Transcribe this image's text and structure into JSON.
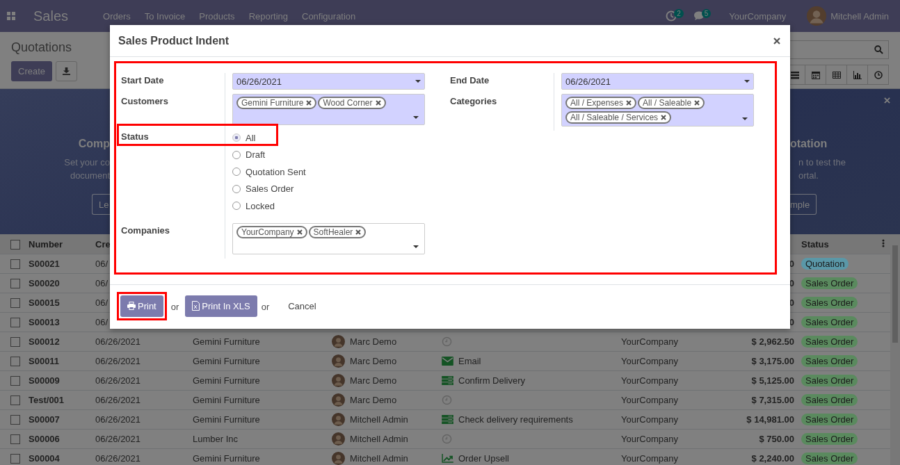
{
  "navbar": {
    "app_name": "Sales",
    "menu": [
      "Orders",
      "To Invoice",
      "Products",
      "Reporting",
      "Configuration"
    ],
    "activity_count": "2",
    "message_count": "5",
    "company": "YourCompany",
    "user": "Mitchell Admin"
  },
  "control_panel": {
    "title": "Quotations",
    "create_button": "Create"
  },
  "banner": {
    "left": {
      "title": "Comp",
      "lines": [
        "Set your co",
        "document"
      ],
      "button": "Le"
    },
    "right": {
      "title": "otation",
      "lines": [
        "n to test the",
        "ortal."
      ],
      "button": "mple"
    }
  },
  "table": {
    "columns": {
      "number": "Number",
      "column_3": "Cre",
      "status": "Status"
    },
    "select_all_checked": false,
    "rows": [
      {
        "checked": false,
        "number": "S00021",
        "date": "06/",
        "total": "0",
        "status": "Quotation",
        "color": "#5a98a8"
      },
      {
        "checked": false,
        "number": "S00020",
        "date": "06/",
        "total": "0",
        "status": "Sales Order",
        "color": "#5a8a5e"
      },
      {
        "checked": false,
        "number": "S00015",
        "date": "06/",
        "total": "0",
        "status": "Sales Order",
        "color": "#5a8a5e"
      },
      {
        "checked": false,
        "number": "S00013",
        "date": "06/",
        "total": "0",
        "status": "Sales Order",
        "color": "#5a8a5e"
      },
      {
        "checked": false,
        "number": "S00012",
        "date": "06/26/2021",
        "customer": "Gemini Furniture",
        "salesperson": "Marc Demo",
        "activity": {
          "kind": "none"
        },
        "company": "YourCompany",
        "total": "$ 2,962.50",
        "status": "Sales Order",
        "color": "#5a8a5e"
      },
      {
        "checked": false,
        "number": "S00011",
        "date": "06/26/2021",
        "customer": "Gemini Furniture",
        "salesperson": "Marc Demo",
        "activity": {
          "kind": "email",
          "text": "Email"
        },
        "company": "YourCompany",
        "total": "$ 3,175.00",
        "status": "Sales Order",
        "color": "#5a8a5e"
      },
      {
        "checked": false,
        "number": "S00009",
        "date": "06/26/2021",
        "customer": "Gemini Furniture",
        "salesperson": "Marc Demo",
        "activity": {
          "kind": "todo",
          "text": "Confirm Delivery"
        },
        "company": "YourCompany",
        "total": "$ 5,125.00",
        "status": "Sales Order",
        "color": "#5a8a5e"
      },
      {
        "checked": false,
        "number": "Test/001",
        "date": "06/26/2021",
        "customer": "Gemini Furniture",
        "salesperson": "Marc Demo",
        "activity": {
          "kind": "none"
        },
        "company": "YourCompany",
        "total": "$ 7,315.00",
        "status": "Sales Order",
        "color": "#5a8a5e"
      },
      {
        "checked": false,
        "number": "S00007",
        "date": "06/26/2021",
        "customer": "Gemini Furniture",
        "salesperson": "Mitchell Admin",
        "activity": {
          "kind": "todo",
          "text": "Check delivery requirements"
        },
        "company": "YourCompany",
        "total": "$ 14,981.00",
        "status": "Sales Order",
        "color": "#5a8a5e"
      },
      {
        "checked": false,
        "number": "S00006",
        "date": "06/26/2021",
        "customer": "Lumber Inc",
        "salesperson": "Mitchell Admin",
        "activity": {
          "kind": "none"
        },
        "company": "YourCompany",
        "total": "$ 750.00",
        "status": "Sales Order",
        "color": "#5a8a5e"
      },
      {
        "checked": false,
        "number": "S00004",
        "date": "06/26/2021",
        "customer": "Gemini Furniture",
        "salesperson": "Mitchell Admin",
        "activity": {
          "kind": "upsell",
          "text": "Order Upsell"
        },
        "company": "YourCompany",
        "total": "$ 2,240.00",
        "status": "Sales Order",
        "color": "#5a8a5e"
      }
    ]
  },
  "dialog": {
    "title": "Sales Product Indent",
    "highlighted": true,
    "left_fields": [
      {
        "label": "Start Date",
        "kind": "date",
        "value": "06/26/2021",
        "required": true
      },
      {
        "label": "Customers",
        "kind": "tags",
        "tags": [
          "Gemini Furniture",
          "Wood Corner"
        ],
        "required": true
      },
      {
        "label": "Status",
        "kind": "radio",
        "highlighted": true,
        "options": [
          {
            "label": "All",
            "selected": true
          },
          {
            "label": "Draft",
            "selected": false
          },
          {
            "label": "Quotation Sent",
            "selected": false
          },
          {
            "label": "Sales Order",
            "selected": false
          },
          {
            "label": "Locked",
            "selected": false
          }
        ]
      },
      {
        "label": "Companies",
        "kind": "tags",
        "tags": [
          "YourCompany",
          "SoftHealer"
        ],
        "required": false
      }
    ],
    "right_fields": [
      {
        "label": "End Date",
        "kind": "date",
        "value": "06/26/2021",
        "required": true
      },
      {
        "label": "Categories",
        "kind": "tags",
        "tags": [
          "All / Expenses",
          "All / Saleable",
          "All / Saleable / Services"
        ],
        "required": true
      }
    ],
    "footer": {
      "print_button": "Print",
      "print_highlighted": true,
      "separator_1": "or",
      "xls_button": "Print In XLS",
      "separator_2": "or",
      "cancel_button": "Cancel"
    }
  }
}
